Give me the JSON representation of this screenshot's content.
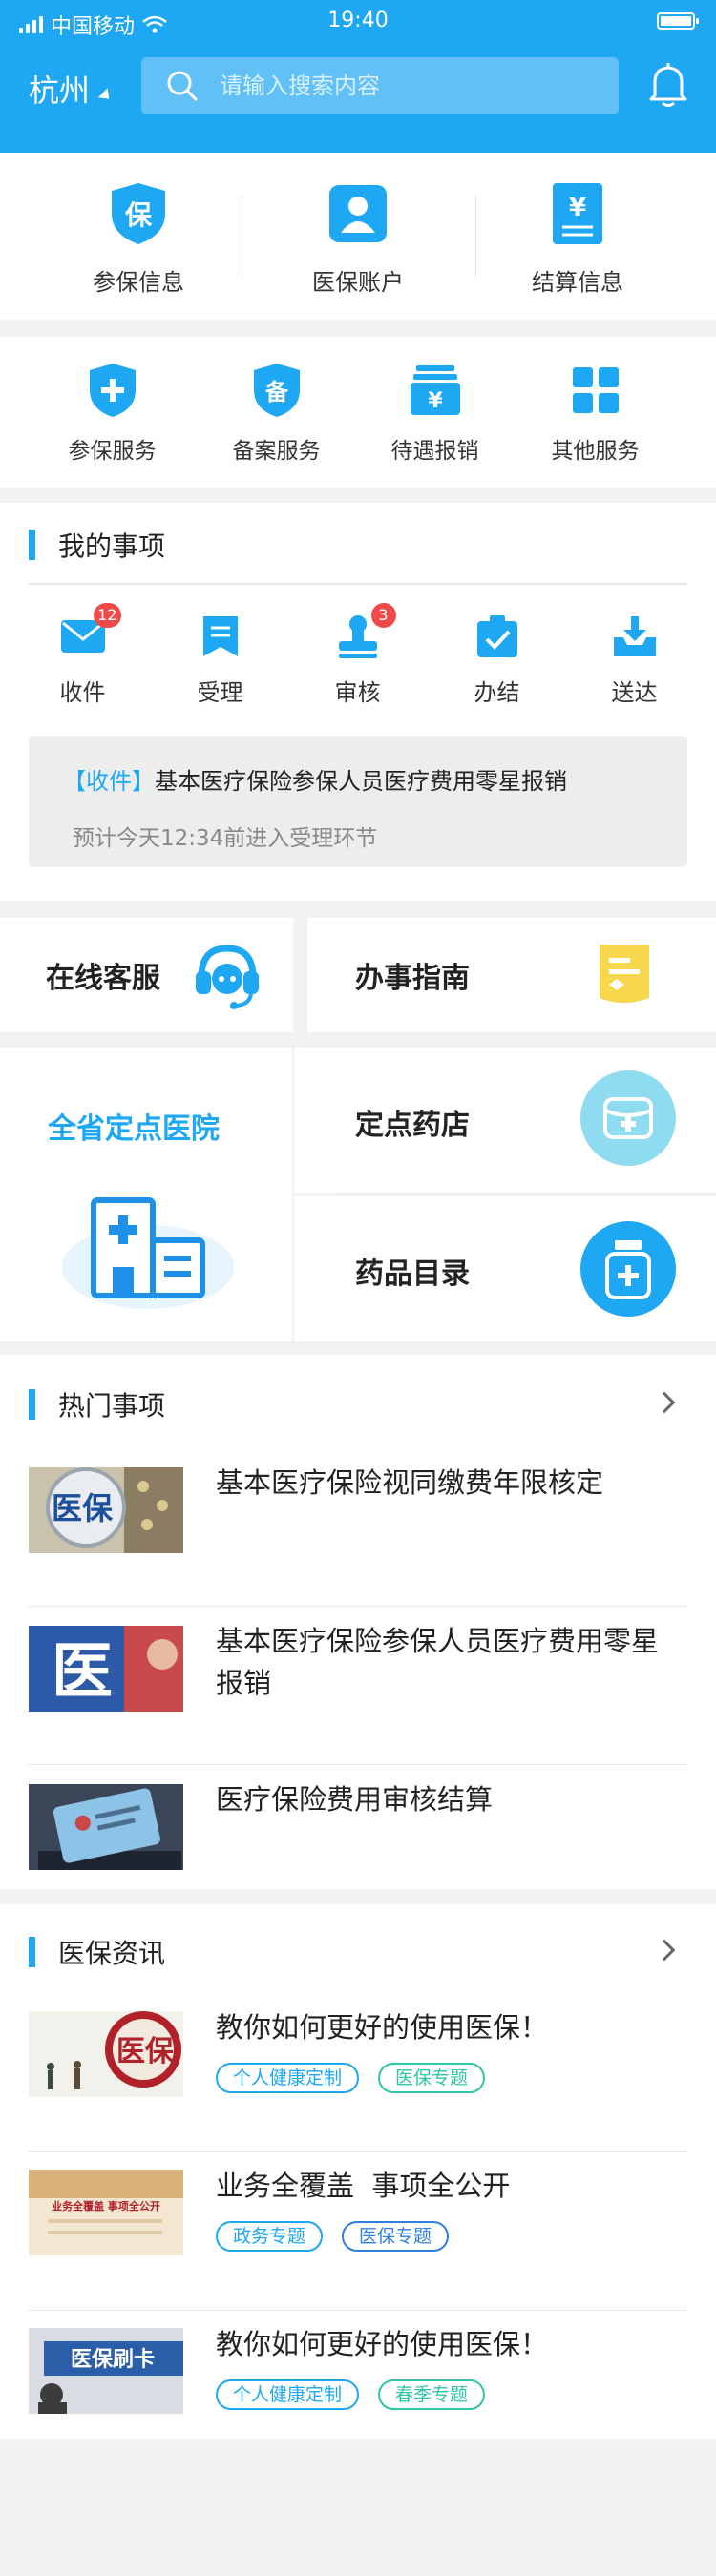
{
  "status_bar": {
    "carrier": "中国移动",
    "time": "19:40"
  },
  "header": {
    "city": "杭州",
    "search_placeholder": "请输入搜索内容"
  },
  "info_row": [
    {
      "label": "参保信息",
      "icon": "shield-bao-icon"
    },
    {
      "label": "医保账户",
      "icon": "user-account-icon"
    },
    {
      "label": "结算信息",
      "icon": "yen-document-icon"
    }
  ],
  "service_row": [
    {
      "label": "参保服务",
      "icon": "shield-plus-icon"
    },
    {
      "label": "备案服务",
      "icon": "shield-bei-icon"
    },
    {
      "label": "待遇报销",
      "icon": "yen-box-icon"
    },
    {
      "label": "其他服务",
      "icon": "grid-icon"
    }
  ],
  "my_items": {
    "title": "我的事项",
    "items": [
      {
        "label": "收件",
        "icon": "mail-icon",
        "badge": "12"
      },
      {
        "label": "受理",
        "icon": "bookmark-icon",
        "badge": ""
      },
      {
        "label": "审核",
        "icon": "stamp-icon",
        "badge": "3"
      },
      {
        "label": "办结",
        "icon": "check-box-icon",
        "badge": ""
      },
      {
        "label": "送达",
        "icon": "inbox-download-icon",
        "badge": ""
      }
    ],
    "notice": {
      "tag": "【收件】",
      "title": "基本医疗保险参保人员医疗费用零星报销",
      "subtitle": "预计今天12:34前进入受理环节"
    }
  },
  "cards": {
    "online_service": "在线客服",
    "guide": "办事指南",
    "hospitals": "全省定点医院",
    "pharmacy": "定点药店",
    "drug_list": "药品目录"
  },
  "hot": {
    "title": "热门事项",
    "items": [
      {
        "title": "基本医疗保险视同缴费年限核定",
        "thumb_text": "医保"
      },
      {
        "title": "基本医疗保险参保人员医疗费用零星报销",
        "thumb_text": "医"
      },
      {
        "title": "医疗保险费用审核结算",
        "thumb_text": ""
      }
    ]
  },
  "news": {
    "title": "医保资讯",
    "items": [
      {
        "title": "教你如何更好的使用医保！",
        "thumb_text": "医保",
        "tags": [
          {
            "text": "个人健康定制",
            "color": "#1ea7f2"
          },
          {
            "text": "医保专题",
            "color": "#2fc6a5"
          }
        ]
      },
      {
        "title": "业务全覆盖  事项全公开",
        "thumb_text": "业务全覆盖 事项全公开",
        "tags": [
          {
            "text": "政务专题",
            "color": "#1ea7f2"
          },
          {
            "text": "医保专题",
            "color": "#2f7fe0"
          }
        ]
      },
      {
        "title": "教你如何更好的使用医保！",
        "thumb_text": "医保刷卡",
        "tags": [
          {
            "text": "个人健康定制",
            "color": "#1ea7f2"
          },
          {
            "text": "春季专题",
            "color": "#2fc6a5"
          }
        ]
      }
    ]
  },
  "colors": {
    "primary": "#1ea7f2",
    "badge": "#ef4a4a",
    "guide_yellow": "#f7d74e",
    "light_cyan": "#8fdcf0"
  }
}
